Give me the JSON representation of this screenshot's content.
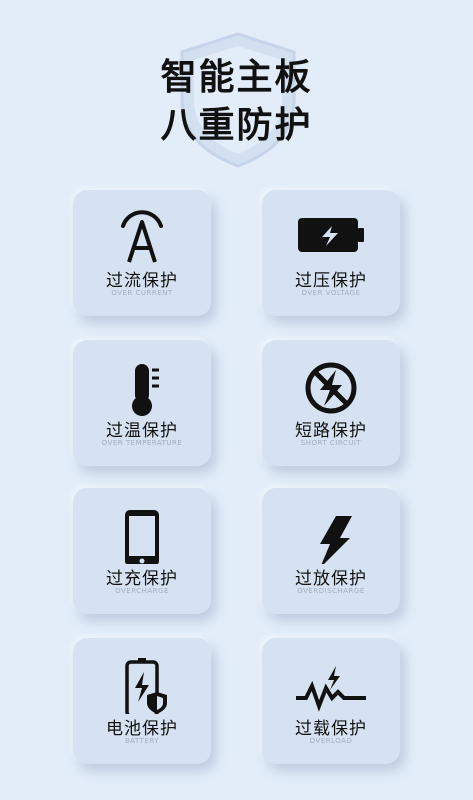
{
  "header": {
    "title_line1": "智能主板",
    "title_line2": "八重防护"
  },
  "cards": [
    {
      "label": "过流保护",
      "sub": "OVER CURRENT",
      "icon": "current-icon"
    },
    {
      "label": "过压保护",
      "sub": "OVER VOLTAGE",
      "icon": "battery-voltage-icon"
    },
    {
      "label": "过温保护",
      "sub": "OVER TEMPERATURE",
      "icon": "thermometer-icon"
    },
    {
      "label": "短路保护",
      "sub": "SHORT CIRCUIT",
      "icon": "no-lightning-icon"
    },
    {
      "label": "过充保护",
      "sub": "OVERCHARGE",
      "icon": "phone-icon"
    },
    {
      "label": "过放保护",
      "sub": "OVERDISCHARGE",
      "icon": "lightning-icon"
    },
    {
      "label": "电池保护",
      "sub": "BATTERY",
      "icon": "battery-shield-icon"
    },
    {
      "label": "过载保护",
      "sub": "OVERLOAD",
      "icon": "overload-pulse-icon"
    }
  ],
  "colors": {
    "background": "#e3edfa",
    "card": "#d6e2f1",
    "icon": "#111111",
    "subtext": "#a2adbd"
  }
}
